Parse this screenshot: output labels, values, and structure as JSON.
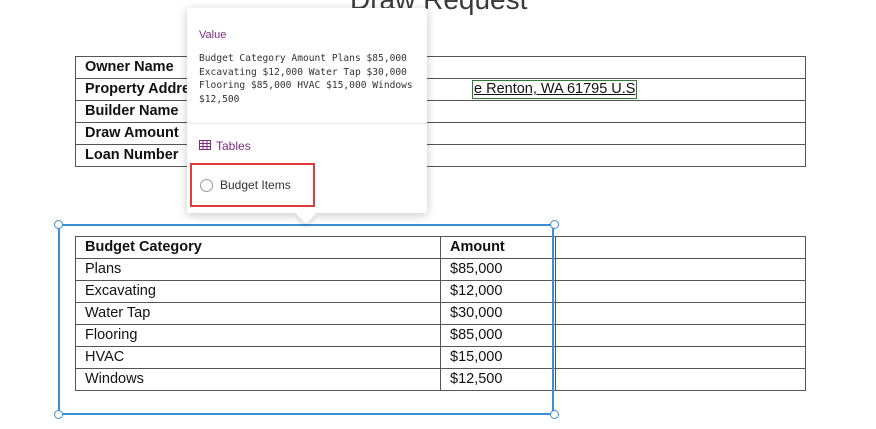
{
  "doc_title": "Draw Request",
  "info_rows": [
    {
      "label": "Owner Name",
      "value": ""
    },
    {
      "label": "Property Address",
      "value": "e Renton, WA 61795 U.S"
    },
    {
      "label": "Builder Name",
      "value": ""
    },
    {
      "label": "Draw Amount",
      "value": ""
    },
    {
      "label": "Loan Number",
      "value": ""
    }
  ],
  "budget_table": {
    "headers": [
      "Budget Category",
      "Amount"
    ],
    "rows": [
      [
        "Plans",
        "$85,000"
      ],
      [
        "Excavating",
        "$12,000"
      ],
      [
        "Water Tap",
        "$30,000"
      ],
      [
        "Flooring",
        "$85,000"
      ],
      [
        "HVAC",
        "$15,000"
      ],
      [
        "Windows",
        "$12,500"
      ]
    ]
  },
  "popup": {
    "header": "Value",
    "value_text": "Budget Category Amount Plans $85,000 Excavating $12,000 Water Tap $30,000 Flooring $85,000 HVAC $15,000 Windows $12,500",
    "tables_label": "Tables",
    "budget_items_label": "Budget Items"
  },
  "colors": {
    "accent_purple": "#7b2d83",
    "selection_blue": "#3b8ed8",
    "highlight_red": "#e23b3b",
    "address_border_green": "#2e7d32"
  }
}
